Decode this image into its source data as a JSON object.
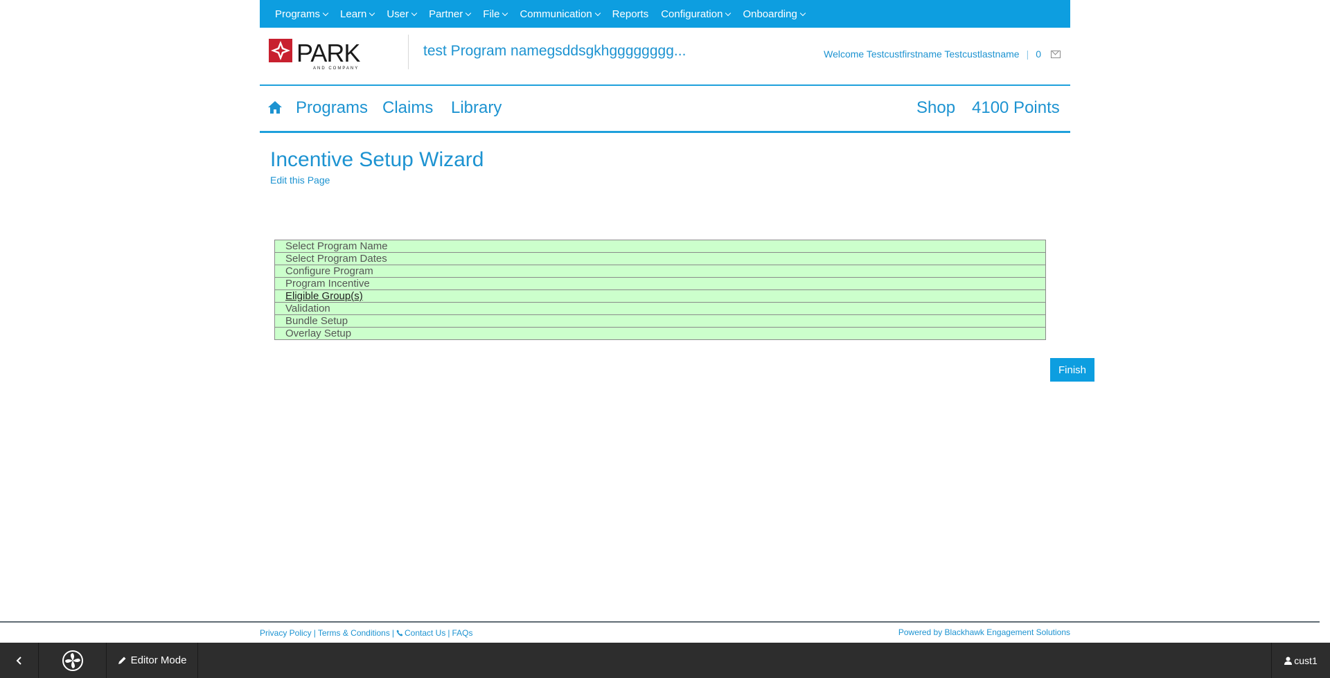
{
  "topnav": {
    "items": [
      {
        "label": "Programs",
        "dropdown": true
      },
      {
        "label": "Learn",
        "dropdown": true
      },
      {
        "label": "User",
        "dropdown": true
      },
      {
        "label": "Partner",
        "dropdown": true
      },
      {
        "label": "File",
        "dropdown": true
      },
      {
        "label": "Communication",
        "dropdown": true
      },
      {
        "label": "Reports",
        "dropdown": false
      },
      {
        "label": "Configuration",
        "dropdown": true
      },
      {
        "label": "Onboarding",
        "dropdown": true
      }
    ]
  },
  "header": {
    "logo_text": "PARK",
    "logo_subtext": "AND COMPANY",
    "program_title": "test Program namegsddsgkhgggggggg...",
    "welcome": "Welcome Testcustfirstname Testcustlastname",
    "separator": "|",
    "message_count": "0"
  },
  "mainnav": {
    "programs": "Programs",
    "claims": "Claims",
    "library": "Library",
    "shop": "Shop",
    "points": "4100 Points"
  },
  "page": {
    "title": "Incentive Setup Wizard",
    "edit_link": "Edit this Page"
  },
  "wizard": {
    "steps": [
      "Select Program Name",
      "Select Program Dates",
      "Configure Program",
      "Program Incentive",
      "Eligible Group(s)",
      "Validation",
      "Bundle Setup",
      "Overlay Setup"
    ],
    "active_step": "Eligible Group(s)",
    "finish_label": "Finish"
  },
  "footer": {
    "privacy": "Privacy Policy",
    "terms": "Terms & Conditions",
    "contact": "Contact Us",
    "faqs": "FAQs",
    "separator": "|",
    "powered_by": "Powered by Blackhawk Engagement Solutions"
  },
  "toolbar": {
    "editor_mode": "Editor Mode",
    "user": "cust1"
  },
  "colors": {
    "brand_blue": "#0d9ee0",
    "step_green": "#ccffcc",
    "toolbar_dark": "#2d2d2d"
  }
}
